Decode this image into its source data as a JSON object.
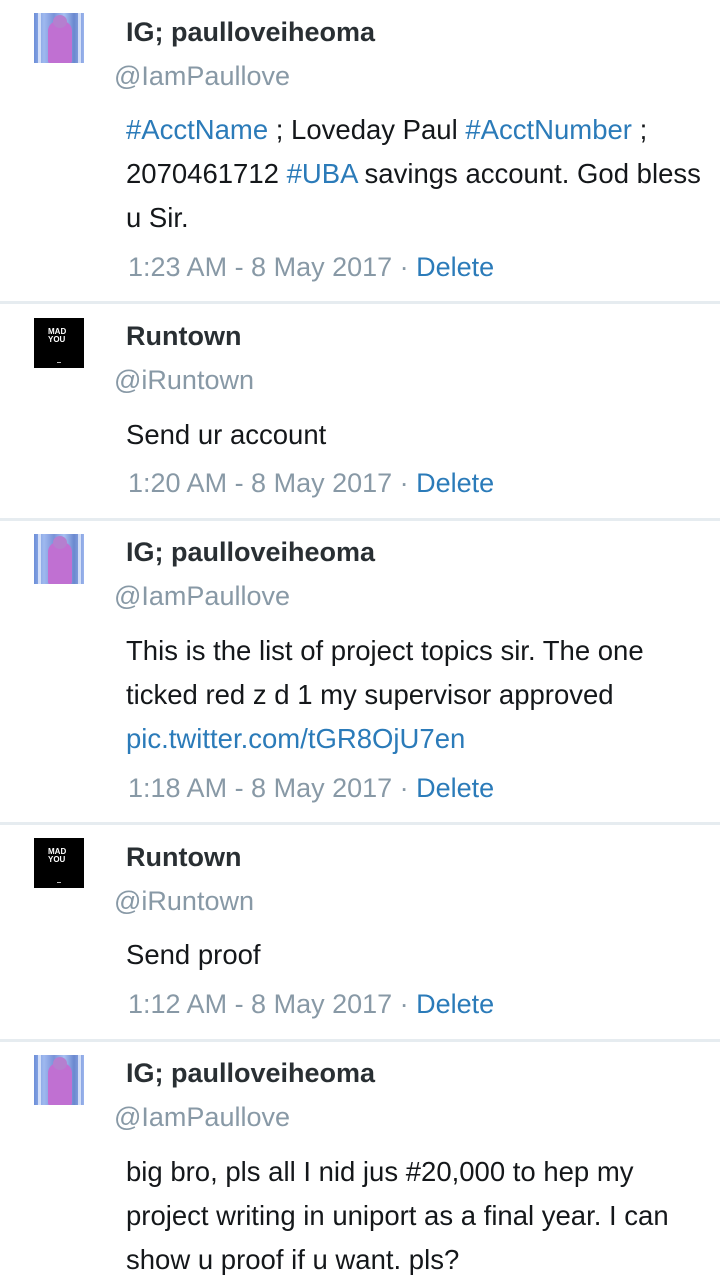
{
  "tweets": [
    {
      "name": "IG; paulloveiheoma",
      "handle": "@IamPaullove",
      "text_parts": [
        "#AcctName",
        " ; Loveday Paul ",
        "#AcctNumber",
        " ; 2070461712 ",
        "#UBA",
        " savings account. God bless u Sir."
      ],
      "timestamp": "1:23  AM - 8  May 2017",
      "sep": " · ",
      "delete": "Delete"
    },
    {
      "name": "Runtown",
      "handle": "@iRuntown",
      "text": "Send ur account",
      "timestamp": "1:20  AM - 8  May 2017",
      "sep": " · ",
      "delete": "Delete",
      "avatar_text": [
        "MAD",
        "YOU"
      ]
    },
    {
      "name": "IG; paulloveiheoma",
      "handle": "@IamPaullove",
      "text": "This is the list of project topics sir. The one ticked red z d 1 my supervisor approved ",
      "link": "pic.twitter.com/tGR8OjU7en",
      "timestamp": "1:18  AM - 8  May 2017",
      "sep": " · ",
      "delete": "Delete"
    },
    {
      "name": "Runtown",
      "handle": "@iRuntown",
      "text": "Send proof",
      "timestamp": "1:12  AM - 8  May 2017",
      "sep": " · ",
      "delete": "Delete",
      "avatar_text": [
        "MAD",
        "YOU"
      ]
    },
    {
      "name": "IG; paulloveiheoma",
      "handle": "@IamPaullove",
      "text": "big bro, pls all I nid jus #20,000  to hep my project writing in uniport as a final year. I can show u proof if u want. pls?"
    }
  ],
  "colors": {
    "link": "#2b7bb9",
    "muted": "#8899a6",
    "divider": "#e6ecf0"
  },
  "icons": {
    "paul_avatar": "profile-photo",
    "runtown_avatar": "mad-you-album-art"
  }
}
